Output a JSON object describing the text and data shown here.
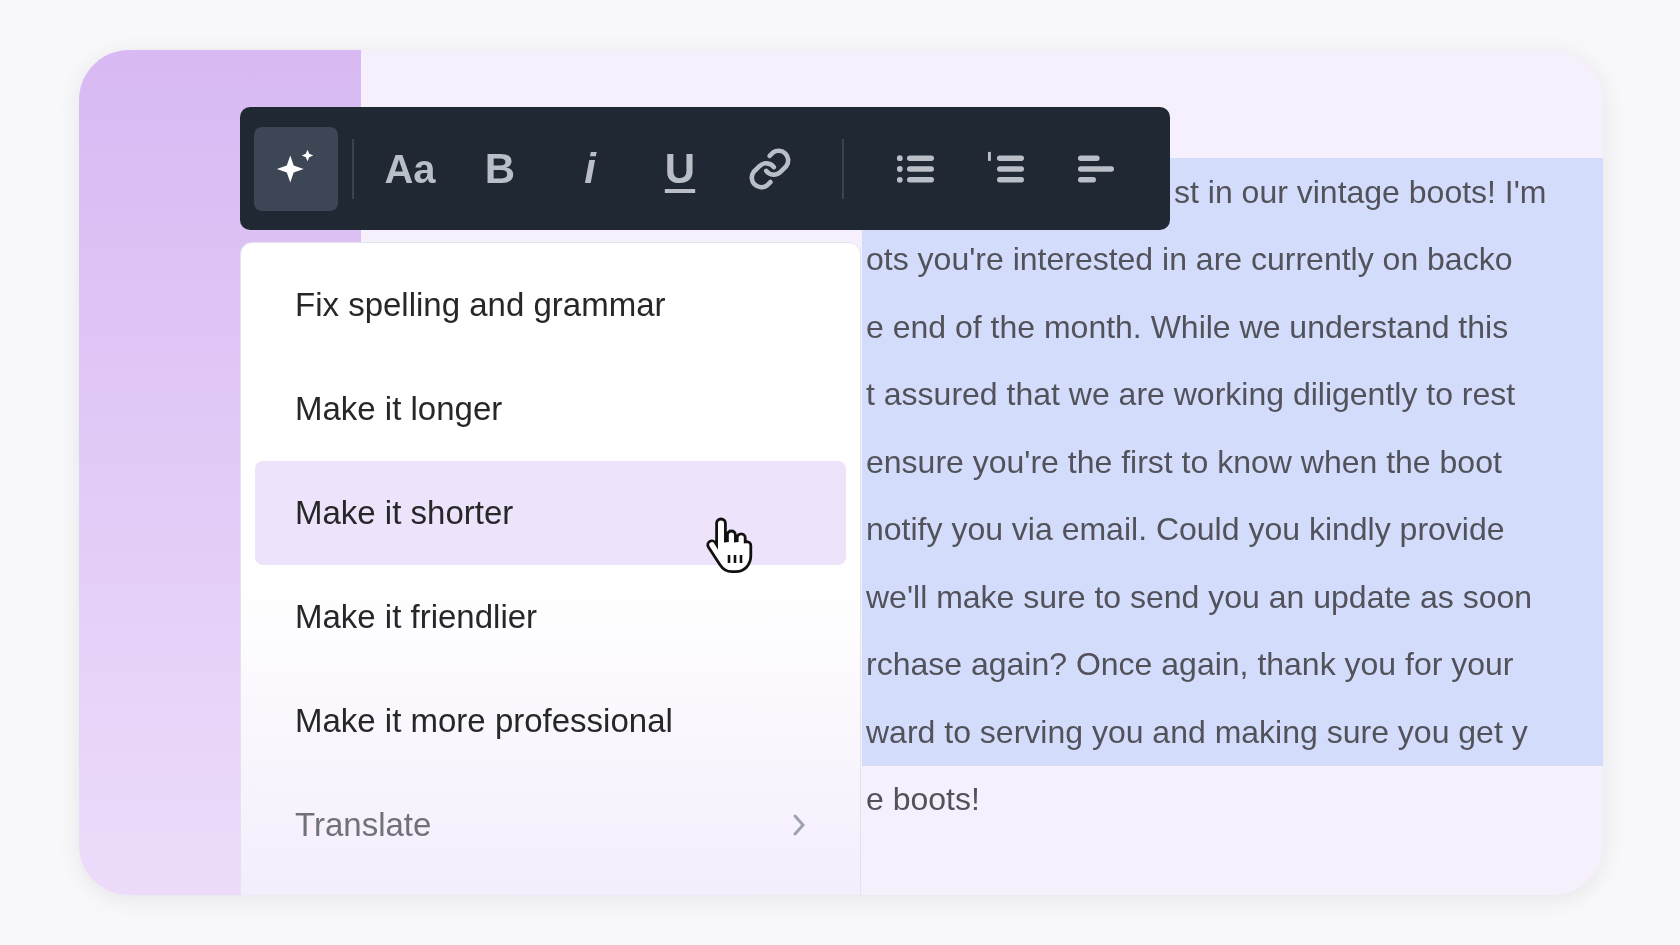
{
  "toolbar": {
    "buttons": [
      {
        "kind": "ai",
        "selected": true
      },
      {
        "kind": "text",
        "label": "Aa",
        "selected": false
      },
      {
        "kind": "bold",
        "label": "B",
        "selected": false
      },
      {
        "kind": "italic",
        "label": "i",
        "selected": false
      },
      {
        "kind": "underline",
        "label": "U",
        "selected": false
      },
      {
        "kind": "link",
        "selected": false
      },
      {
        "kind": "bullets",
        "selected": false
      },
      {
        "kind": "numbers",
        "selected": false
      },
      {
        "kind": "align",
        "selected": false
      }
    ]
  },
  "menu": {
    "items": [
      {
        "label": "Fix spelling and grammar",
        "selected": false,
        "submenu": false
      },
      {
        "label": "Make it longer",
        "selected": false,
        "submenu": false
      },
      {
        "label": "Make it shorter",
        "selected": true,
        "submenu": false
      },
      {
        "label": "Make it friendlier",
        "selected": false,
        "submenu": false
      },
      {
        "label": "Make it more professional",
        "selected": false,
        "submenu": false
      },
      {
        "label": "Translate",
        "selected": false,
        "submenu": true
      }
    ]
  },
  "document": {
    "lines": [
      {
        "text": "st in our vintage boots! I'm",
        "highlighted": true
      },
      {
        "text": "ots you're interested in are currently on backo",
        "highlighted": true
      },
      {
        "text": "e end of the month. While we understand this",
        "highlighted": true
      },
      {
        "text": "t assured that we are working diligently to rest",
        "highlighted": true
      },
      {
        "text": "ensure you're the first to know when the boot",
        "highlighted": true
      },
      {
        "text": "notify you via email. Could you kindly provide",
        "highlighted": true
      },
      {
        "text": "we'll make sure to send you an update as soon",
        "highlighted": true
      },
      {
        "text": "rchase again? Once again, thank you for your",
        "highlighted": true
      },
      {
        "text": "ward to serving you and making sure you get y",
        "highlighted": true
      },
      {
        "text": "e boots!",
        "highlighted": false
      }
    ]
  }
}
